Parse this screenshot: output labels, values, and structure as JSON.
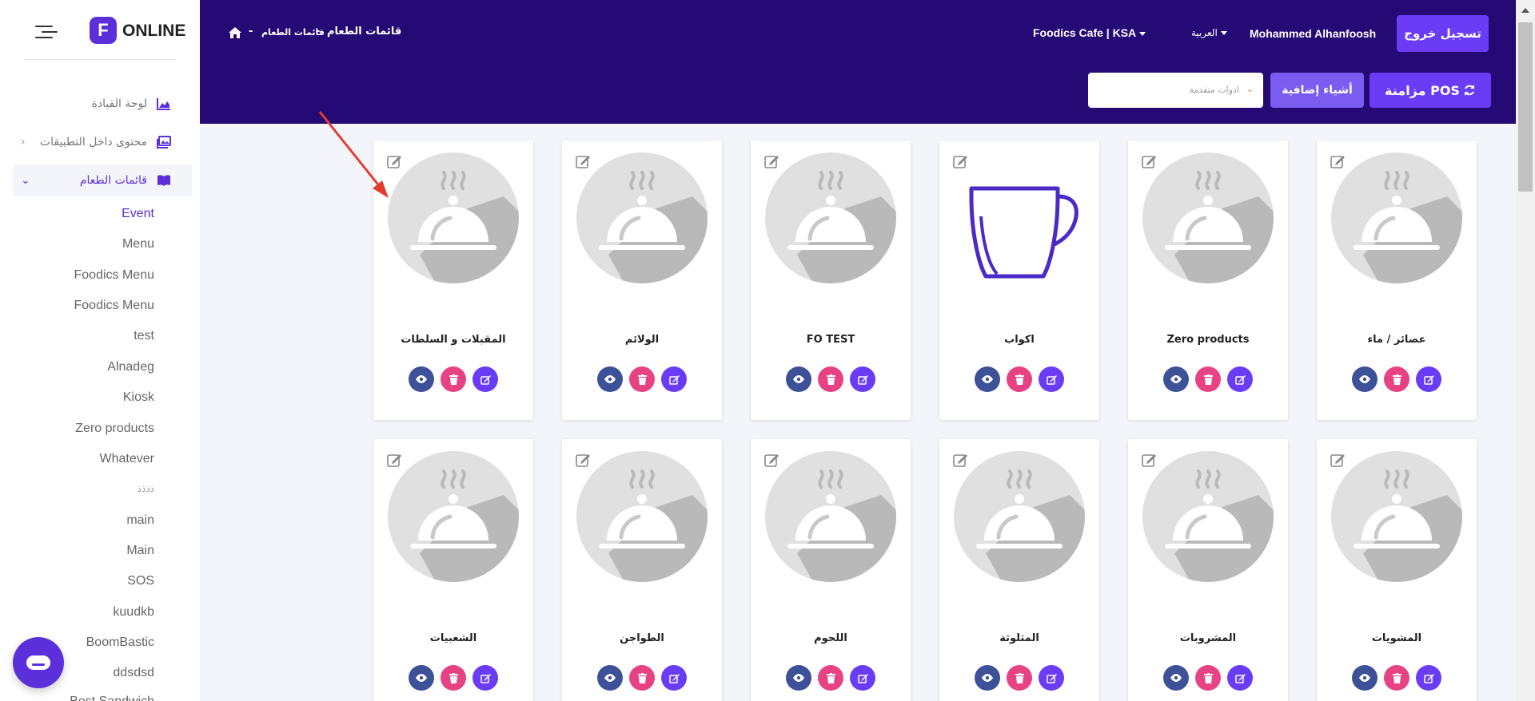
{
  "sidebar": {
    "logo_letter": "F",
    "logo_text": "ONLINE",
    "nav": [
      {
        "label": "لوحة القيادة",
        "icon": "chart-area-icon"
      },
      {
        "label": "محتوى داخل التطبيقات",
        "icon": "images-icon"
      },
      {
        "label": "قائمات الطعام",
        "icon": "book-open-icon"
      }
    ],
    "sub_items": [
      "Event",
      "Menu",
      "Foodics Menu",
      "Foodics Menu",
      "test",
      "Alnadeg",
      "Kiosk",
      "Zero products",
      "Whatever",
      "ذذذذ",
      "main",
      "Main",
      "SOS",
      "kuudkb",
      "BoomBastic",
      "ddsdsd",
      "Best Sandwich"
    ]
  },
  "header": {
    "breadcrumb_1": "قائمات الطعام",
    "breadcrumb_2": "قائمات الطعام",
    "separator": "-",
    "logout": "تسجيل خروج",
    "user": "Mohammed Alhanfoosh",
    "language": "العربية",
    "brand": "Foodics Cafe | KSA",
    "pos_sync": "مزامنة POS",
    "extra_items": "أشياء إضافية",
    "advanced_tools_placeholder": "ادوات متقدمة"
  },
  "cards": [
    {
      "title": "المقبلات و السلطات",
      "image": "cloche-icon"
    },
    {
      "title": "الولائم",
      "image": "cloche-icon"
    },
    {
      "title": "FO TEST",
      "image": "cloche-icon"
    },
    {
      "title": "اكواب",
      "image": "mug-icon"
    },
    {
      "title": "Zero products",
      "image": "cloche-icon"
    },
    {
      "title": "عصائر / ماء",
      "image": "cloche-icon"
    },
    {
      "title": "الشعبيات",
      "image": "cloche-icon"
    },
    {
      "title": "الطواجن",
      "image": "cloche-icon"
    },
    {
      "title": "اللحوم",
      "image": "cloche-icon"
    },
    {
      "title": "المثلوثة",
      "image": "cloche-icon"
    },
    {
      "title": "المشروبات",
      "image": "cloche-icon"
    },
    {
      "title": "المشويات",
      "image": "cloche-icon"
    }
  ],
  "colors": {
    "header_bg": "#250a75",
    "accent": "#6a3cf5",
    "view_btn": "#3d5199",
    "delete_btn": "#e74283",
    "edit_btn": "#6a3cf5"
  }
}
